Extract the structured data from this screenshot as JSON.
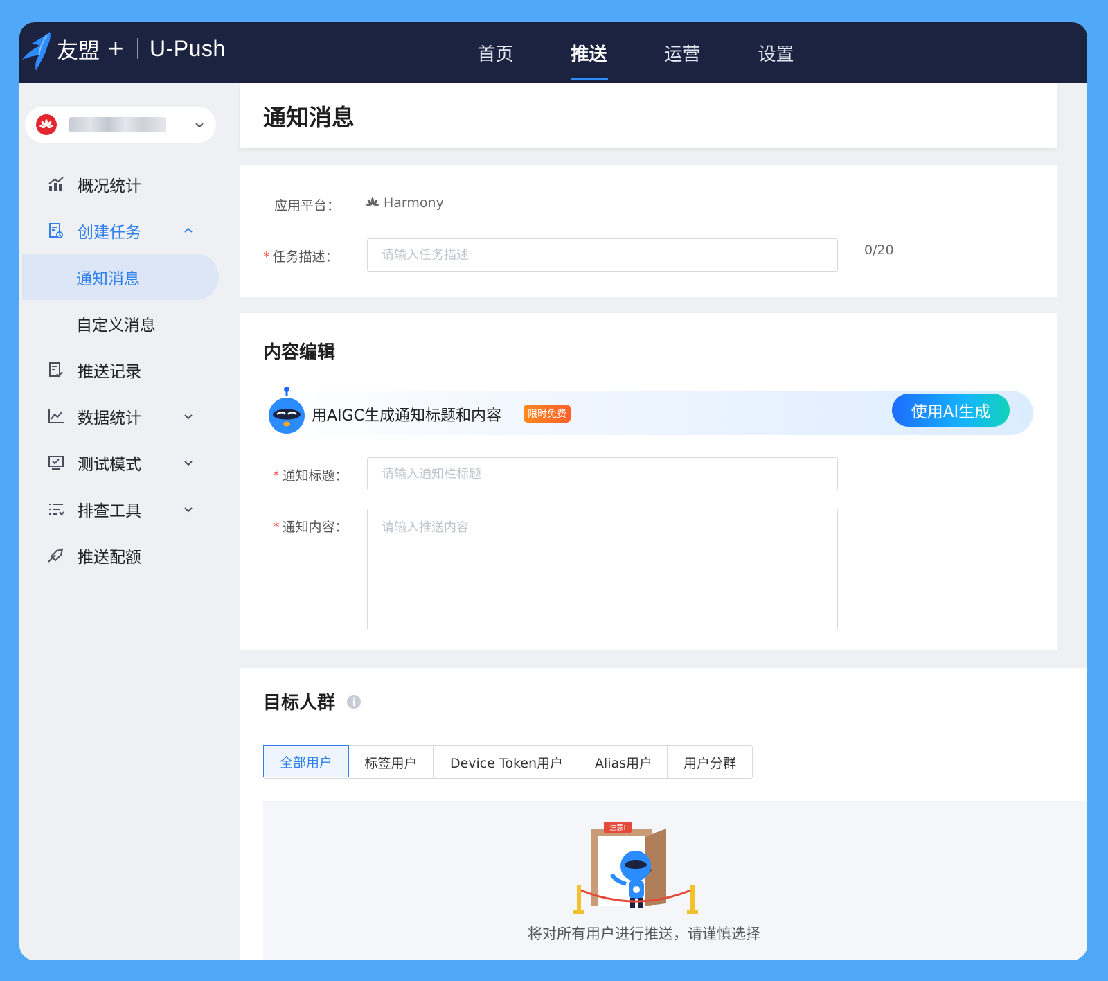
{
  "brand": {
    "name": "友盟",
    "plus": "+",
    "product": "U-Push"
  },
  "nav": [
    {
      "label": "首页",
      "active": false
    },
    {
      "label": "推送",
      "active": true
    },
    {
      "label": "运营",
      "active": false
    },
    {
      "label": "设置",
      "active": false
    }
  ],
  "sidebar": {
    "app_logo": "huawei-logo",
    "menu": [
      {
        "label": "概况统计",
        "icon": "chart-icon"
      },
      {
        "label": "创建任务",
        "icon": "task-icon",
        "expanded": true,
        "children": [
          {
            "label": "通知消息",
            "active": true
          },
          {
            "label": "自定义消息",
            "active": false
          }
        ]
      },
      {
        "label": "推送记录",
        "icon": "record-icon"
      },
      {
        "label": "数据统计",
        "icon": "line-chart-icon"
      },
      {
        "label": "测试模式",
        "icon": "monitor-icon"
      },
      {
        "label": "排查工具",
        "icon": "list-icon"
      },
      {
        "label": "推送配额",
        "icon": "plane-icon"
      }
    ]
  },
  "page": {
    "title": "通知消息"
  },
  "basic": {
    "platform_label": "应用平台：",
    "platform_value": "Harmony",
    "task_label": "任务描述：",
    "task_placeholder": "请输入任务描述",
    "task_counter": "0/20"
  },
  "content": {
    "section_title": "内容编辑",
    "aigc_text": "用AIGC生成通知标题和内容",
    "aigc_badge": "限时免费",
    "aigc_button": "使用AI生成",
    "title_label": "通知标题：",
    "title_placeholder": "请输入通知栏标题",
    "body_label": "通知内容：",
    "body_placeholder": "请输入推送内容"
  },
  "target": {
    "section_title": "目标人群",
    "tabs": [
      {
        "label": "全部用户",
        "active": true
      },
      {
        "label": "标签用户",
        "active": false
      },
      {
        "label": "Device Token用户",
        "active": false
      },
      {
        "label": "Alias用户",
        "active": false
      },
      {
        "label": "用户分群",
        "active": false
      }
    ],
    "notice_sign": "注意!",
    "notice_text": "将对所有用户进行推送，请谨慎选择"
  },
  "colors": {
    "topbar": "#1b2340",
    "accent": "#2f80ed",
    "frame": "#4fa8f8",
    "required": "#f04a3c"
  }
}
